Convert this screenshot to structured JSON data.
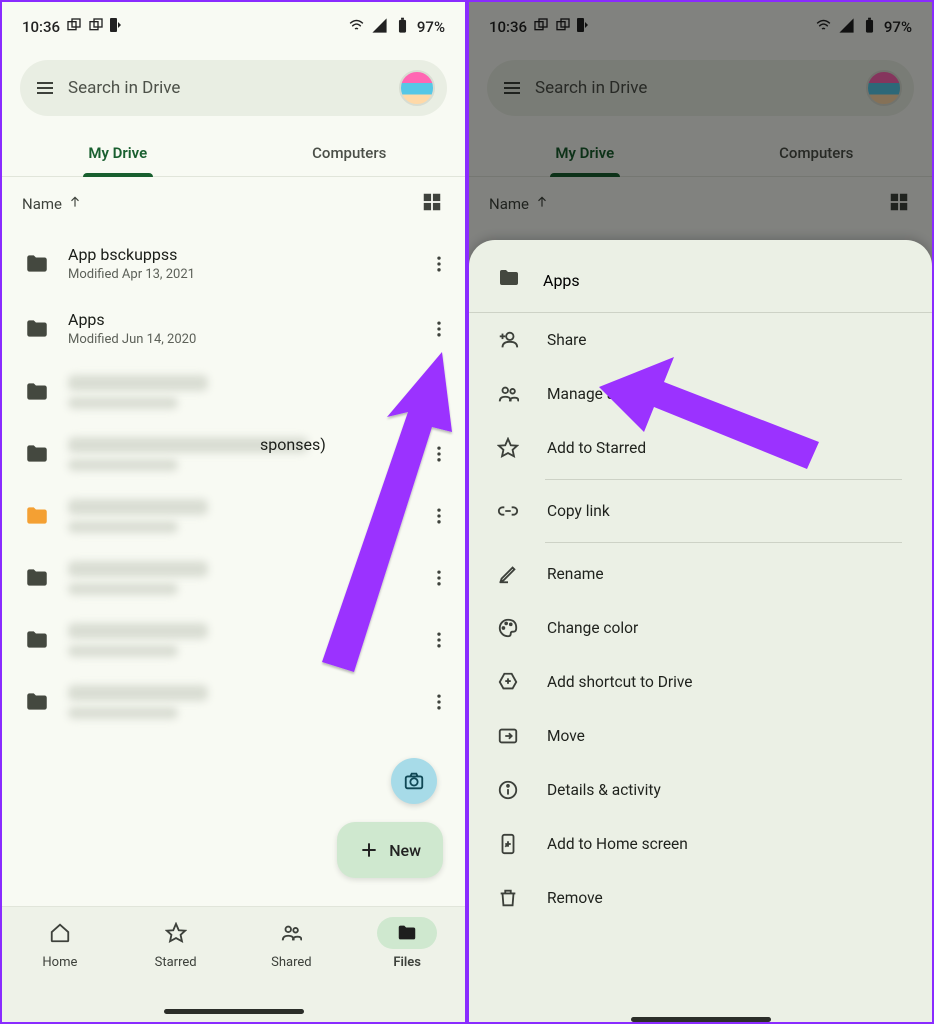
{
  "status": {
    "time": "10:36",
    "battery": "97%"
  },
  "search": {
    "placeholder": "Search in Drive"
  },
  "tabs": [
    {
      "label": "My Drive",
      "active": true
    },
    {
      "label": "Computers",
      "active": false
    }
  ],
  "sort": {
    "label": "Name"
  },
  "files": [
    {
      "title": "App bsckuppss",
      "subtitle": "Modified Apr 13, 2021",
      "blurred": false
    },
    {
      "title": "Apps",
      "subtitle": "Modified Jun 14, 2020",
      "blurred": false
    },
    {
      "title": "",
      "subtitle": "",
      "blurred": true
    },
    {
      "title": "sponses)",
      "subtitle": "",
      "blurred": true,
      "wide": true
    },
    {
      "title": "",
      "subtitle": "",
      "blurred": true,
      "orange": true
    },
    {
      "title": "",
      "subtitle": "",
      "blurred": true
    },
    {
      "title": "",
      "subtitle": "",
      "blurred": true
    },
    {
      "title": "",
      "subtitle": "",
      "blurred": true
    },
    {
      "title": "",
      "subtitle": "",
      "blurred": true
    }
  ],
  "fab": {
    "label": "New"
  },
  "bottomNav": [
    {
      "label": "Home"
    },
    {
      "label": "Starred"
    },
    {
      "label": "Shared"
    },
    {
      "label": "Files",
      "active": true
    }
  ],
  "sheet": {
    "title": "Apps",
    "items": [
      {
        "label": "Share",
        "icon": "person-add"
      },
      {
        "label": "Manage access",
        "icon": "people"
      },
      {
        "label": "Add to Starred",
        "icon": "star"
      },
      {
        "divider": true
      },
      {
        "label": "Copy link",
        "icon": "link"
      },
      {
        "divider": true
      },
      {
        "label": "Rename",
        "icon": "pencil"
      },
      {
        "label": "Change color",
        "icon": "palette"
      },
      {
        "label": "Add shortcut to Drive",
        "icon": "drive-shortcut"
      },
      {
        "label": "Move",
        "icon": "move"
      },
      {
        "label": "Details & activity",
        "icon": "info"
      },
      {
        "label": "Add to Home screen",
        "icon": "home-screen"
      },
      {
        "label": "Remove",
        "icon": "trash"
      }
    ]
  }
}
